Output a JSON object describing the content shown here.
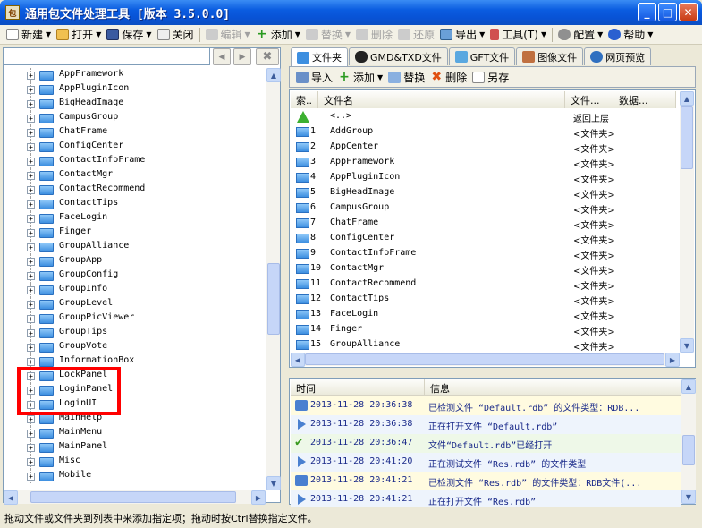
{
  "window": {
    "icon_text": "包",
    "title": "通用包文件处理工具 [版本 3.5.0.0]"
  },
  "toolbar": {
    "items": [
      "新建",
      "打开",
      "保存",
      "关闭",
      "编辑",
      "添加",
      "替换",
      "删除",
      "还原",
      "导出",
      "工具(T)",
      "配置",
      "帮助"
    ]
  },
  "tree": {
    "items": [
      "AppFramework",
      "AppPluginIcon",
      "BigHeadImage",
      "CampusGroup",
      "ChatFrame",
      "ConfigCenter",
      "ContactInfoFrame",
      "ContactMgr",
      "ContactRecommend",
      "ContactTips",
      "FaceLogin",
      "Finger",
      "GroupAlliance",
      "GroupApp",
      "GroupConfig",
      "GroupInfo",
      "GroupLevel",
      "GroupPicViewer",
      "GroupTips",
      "GroupVote",
      "InformationBox",
      "LockPanel",
      "LoginPanel",
      "LoginUI",
      "MainHelp",
      "MainMenu",
      "MainPanel",
      "Misc",
      "Mobile"
    ]
  },
  "tabs": [
    "文件夹",
    "GMD&TXD文件",
    "GFT文件",
    "图像文件",
    "网页预览"
  ],
  "subtoolbar": {
    "import": "导入",
    "add": "添加",
    "replace": "替换",
    "delete": "删除",
    "saveas": "另存"
  },
  "filelist": {
    "headers": [
      "索..",
      "文件名",
      "文件...",
      "数据..."
    ],
    "up_row": {
      "name": "<..>",
      "type": "返回上层"
    },
    "rows": [
      {
        "idx": "1",
        "name": "AddGroup",
        "type": "<文件夹>"
      },
      {
        "idx": "2",
        "name": "AppCenter",
        "type": "<文件夹>"
      },
      {
        "idx": "3",
        "name": "AppFramework",
        "type": "<文件夹>"
      },
      {
        "idx": "4",
        "name": "AppPluginIcon",
        "type": "<文件夹>"
      },
      {
        "idx": "5",
        "name": "BigHeadImage",
        "type": "<文件夹>"
      },
      {
        "idx": "6",
        "name": "CampusGroup",
        "type": "<文件夹>"
      },
      {
        "idx": "7",
        "name": "ChatFrame",
        "type": "<文件夹>"
      },
      {
        "idx": "8",
        "name": "ConfigCenter",
        "type": "<文件夹>"
      },
      {
        "idx": "9",
        "name": "ContactInfoFrame",
        "type": "<文件夹>"
      },
      {
        "idx": "10",
        "name": "ContactMgr",
        "type": "<文件夹>"
      },
      {
        "idx": "11",
        "name": "ContactRecommend",
        "type": "<文件夹>"
      },
      {
        "idx": "12",
        "name": "ContactTips",
        "type": "<文件夹>"
      },
      {
        "idx": "13",
        "name": "FaceLogin",
        "type": "<文件夹>"
      },
      {
        "idx": "14",
        "name": "Finger",
        "type": "<文件夹>"
      },
      {
        "idx": "15",
        "name": "GroupAlliance",
        "type": "<文件夹>"
      }
    ]
  },
  "log": {
    "headers": [
      "时间",
      "信息"
    ],
    "rows": [
      {
        "icon": "info",
        "time": "2013-11-28 20:36:38",
        "msg": "已检测文件 “Default.rdb” 的文件类型：RDB..."
      },
      {
        "icon": "play",
        "time": "2013-11-28 20:36:38",
        "msg": "正在打开文件 “Default.rdb”"
      },
      {
        "icon": "check",
        "time": "2013-11-28 20:36:47",
        "msg": "文件“Default.rdb”已经打开"
      },
      {
        "icon": "play",
        "time": "2013-11-28 20:41:20",
        "msg": "正在测试文件 “Res.rdb” 的文件类型"
      },
      {
        "icon": "info",
        "time": "2013-11-28 20:41:21",
        "msg": "已检测文件 “Res.rdb” 的文件类型：RDB文件(..."
      },
      {
        "icon": "play",
        "time": "2013-11-28 20:41:21",
        "msg": "正在打开文件 “Res.rdb”"
      }
    ]
  },
  "statusbar": {
    "text": "拖动文件或文件夹到列表中来添加指定项；拖动时按Ctrl替换指定文件。"
  },
  "colors": {
    "title_blue": "#0a5ce0",
    "highlight_red": "#ff0000",
    "log_yellow": "#fffbe0",
    "log_blue": "#eef4fc",
    "log_green": "#eef8e8"
  }
}
